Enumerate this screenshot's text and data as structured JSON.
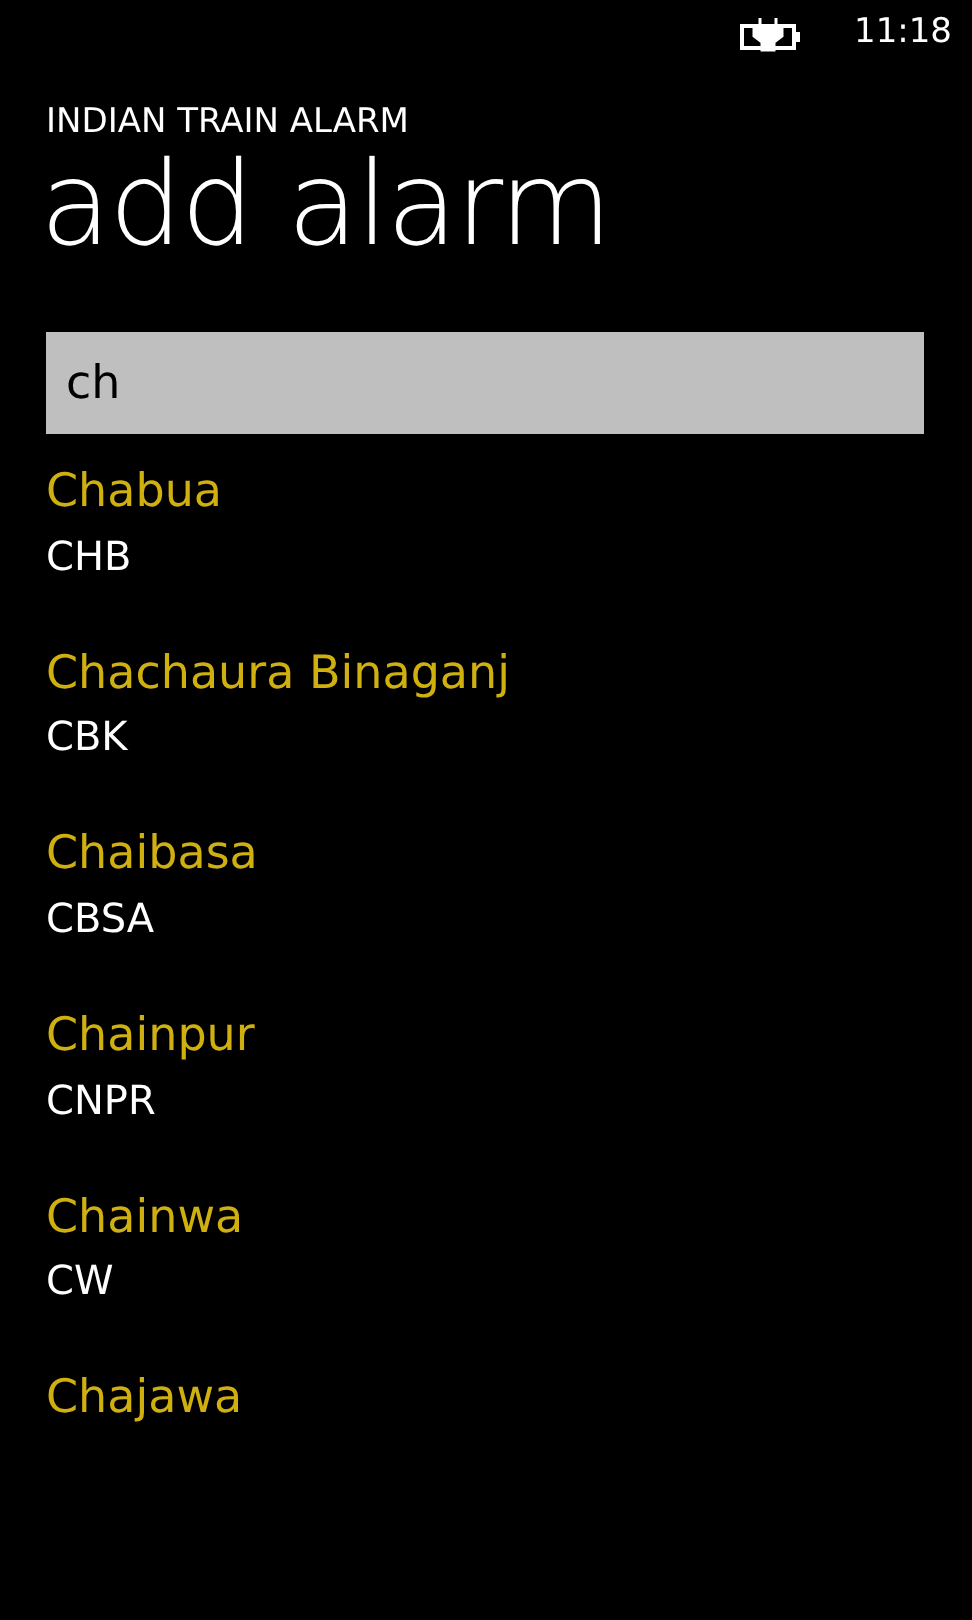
{
  "status_bar": {
    "time": "11:18"
  },
  "app_title": "INDIAN TRAIN ALARM",
  "page_title": "add alarm",
  "search": {
    "value": "ch"
  },
  "stations": [
    {
      "name": "Chabua",
      "code": "CHB"
    },
    {
      "name": "Chachaura Binaganj",
      "code": "CBK"
    },
    {
      "name": "Chaibasa",
      "code": "CBSA"
    },
    {
      "name": "Chainpur",
      "code": "CNPR"
    },
    {
      "name": "Chainwa",
      "code": "CW"
    },
    {
      "name": "Chajawa"
    }
  ]
}
